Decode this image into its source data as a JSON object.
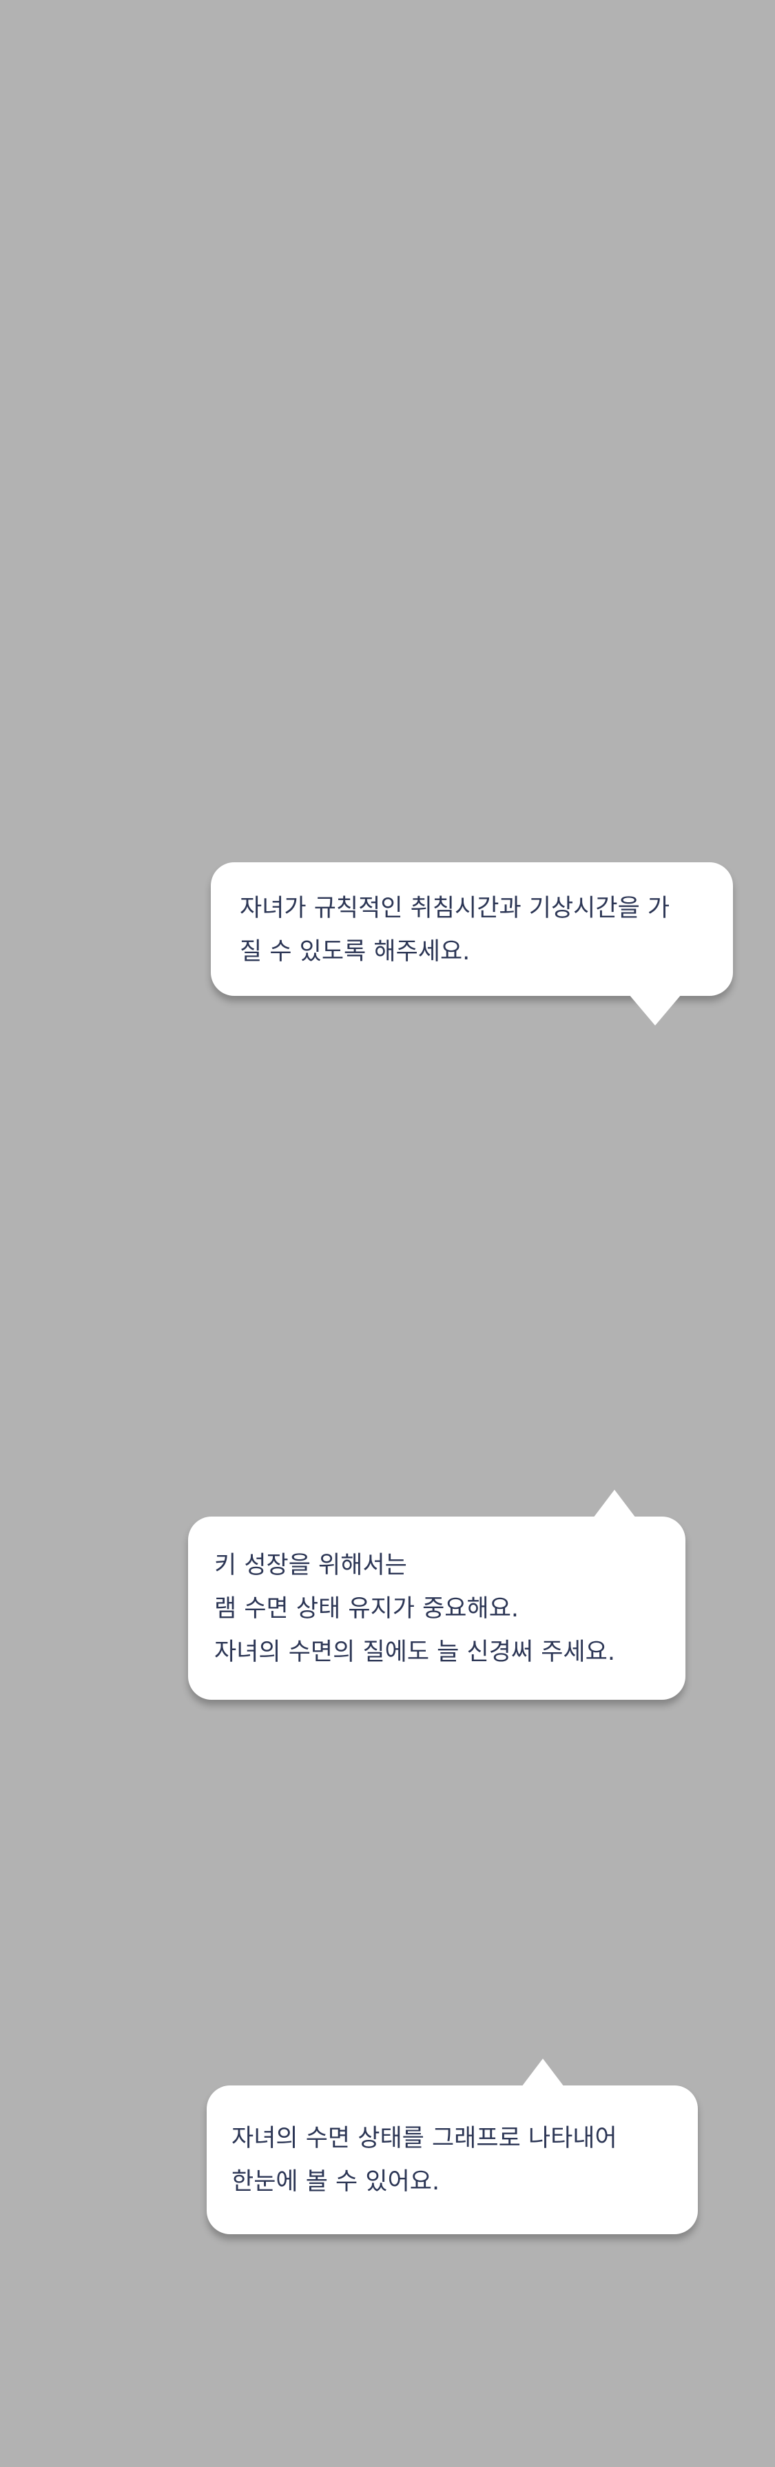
{
  "tooltips": [
    {
      "lines": [
        "자녀가 규칙적인 취침시간과 기상시간을 가",
        "질 수 있도록 해주세요."
      ]
    },
    {
      "lines": [
        "키 성장을 위해서는",
        "램 수면 상태 유지가 중요해요.",
        "자녀의 수면의 질에도 늘 신경써 주세요."
      ]
    },
    {
      "lines": [
        "자녀의 수면 상태를 그래프로 나타내어",
        "한눈에 볼 수 있어요."
      ]
    }
  ]
}
